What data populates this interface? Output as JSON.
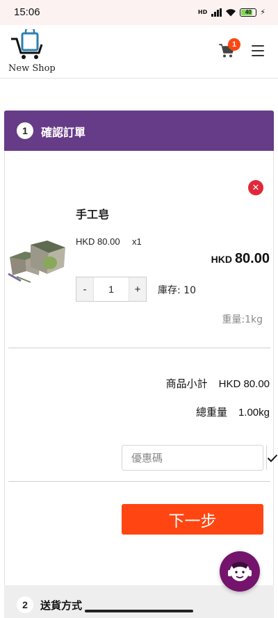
{
  "status_bar": {
    "time": "15:06",
    "network": "HD",
    "battery": "40"
  },
  "header": {
    "logo_text": "New Shop",
    "cart_count": "1"
  },
  "step1": {
    "number": "1",
    "title": "確認訂單",
    "item": {
      "name": "手工皂",
      "unit_price": "HKD 80.00",
      "qty_label": "x1",
      "total_currency": "HKD",
      "total_amount": "80.00",
      "qty_minus": "-",
      "qty_value": "1",
      "qty_plus": "+",
      "stock": "庫存: 10",
      "weight": "重量:1kg"
    },
    "summary": {
      "subtotal_label": "商品小計",
      "subtotal_value": "HKD 80.00",
      "weight_label": "總重量",
      "weight_value": "1.00kg"
    },
    "coupon": {
      "placeholder": "優惠碼"
    },
    "next_button": "下一步"
  },
  "step2": {
    "number": "2",
    "title": "送貨方式"
  },
  "colors": {
    "header_purple": "#663b87",
    "accent_orange": "#ff4612",
    "remove_red": "#e0283a",
    "support_purple": "#74146d"
  }
}
